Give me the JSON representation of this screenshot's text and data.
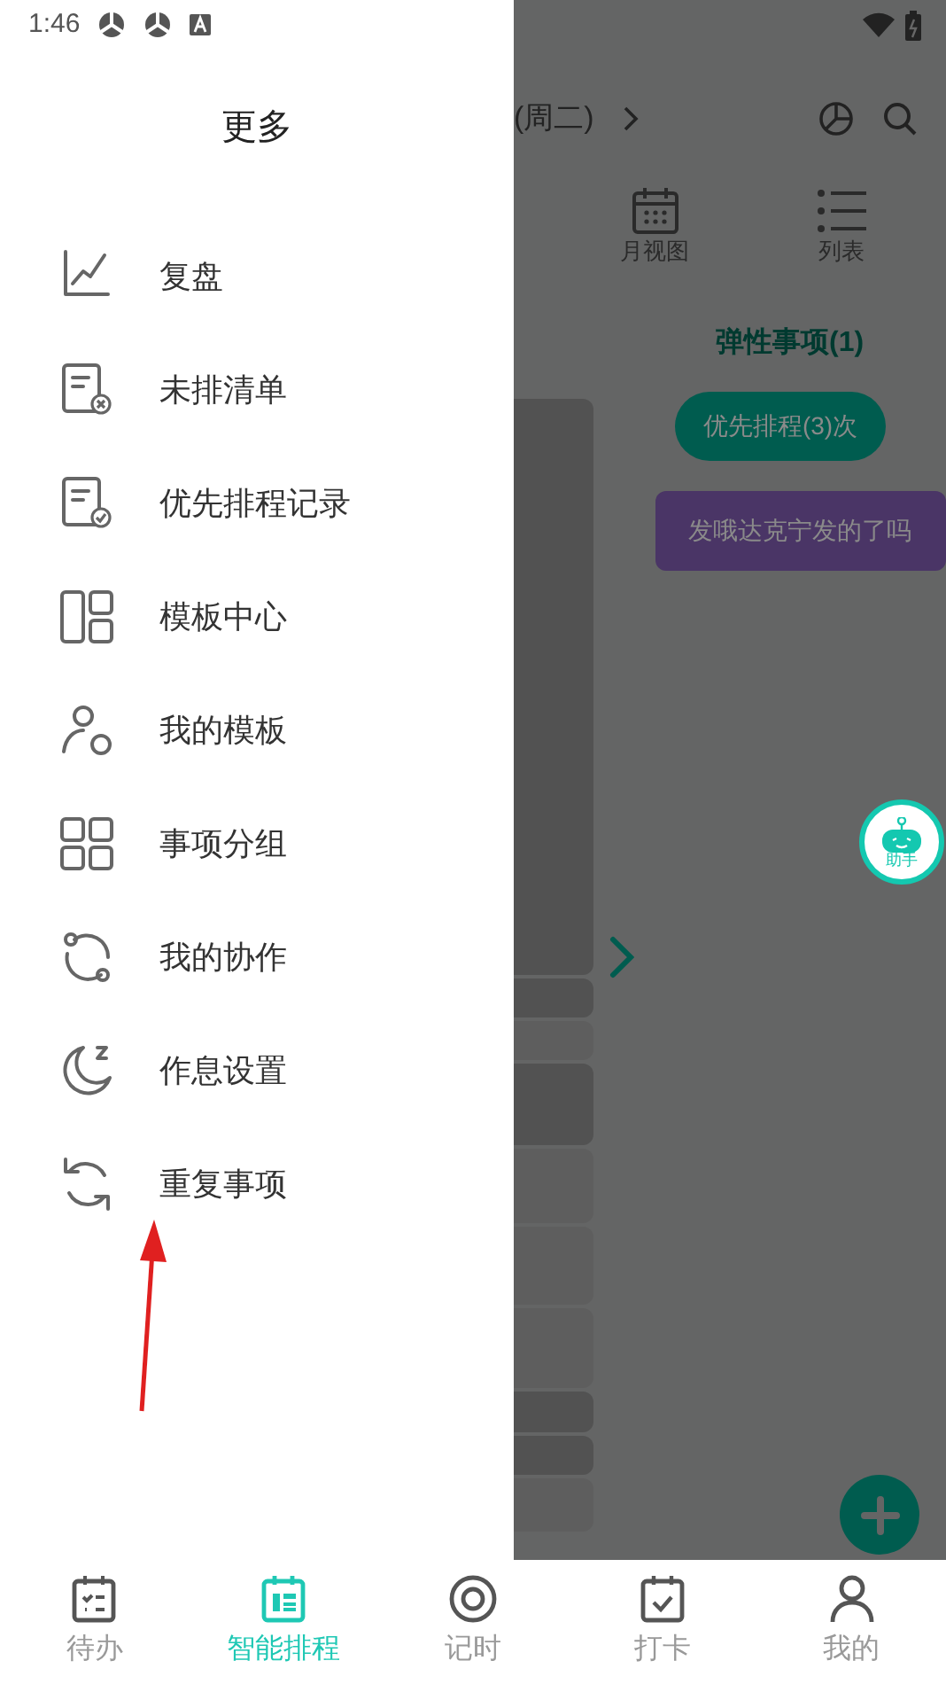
{
  "status_bar": {
    "time": "1:46"
  },
  "drawer": {
    "title": "更多",
    "items": [
      {
        "label": "复盘"
      },
      {
        "label": "未排清单"
      },
      {
        "label": "优先排程记录"
      },
      {
        "label": "模板中心"
      },
      {
        "label": "我的模板"
      },
      {
        "label": "事项分组"
      },
      {
        "label": "我的协作"
      },
      {
        "label": "作息设置"
      },
      {
        "label": "重复事项"
      }
    ]
  },
  "schedule": {
    "date": "(周二)",
    "views": [
      {
        "label": "月视图"
      },
      {
        "label": "列表"
      }
    ],
    "flexible_title": "弹性事项(1)",
    "priority_button": "优先排程(3)次",
    "task_card": "发哦达克宁发的了吗",
    "assistant_label": "助手"
  },
  "bottom_nav": [
    {
      "label": "待办",
      "selected": false
    },
    {
      "label": "智能排程",
      "selected": true
    },
    {
      "label": "记时",
      "selected": false
    },
    {
      "label": "打卡",
      "selected": false
    },
    {
      "label": "我的",
      "selected": false
    }
  ]
}
